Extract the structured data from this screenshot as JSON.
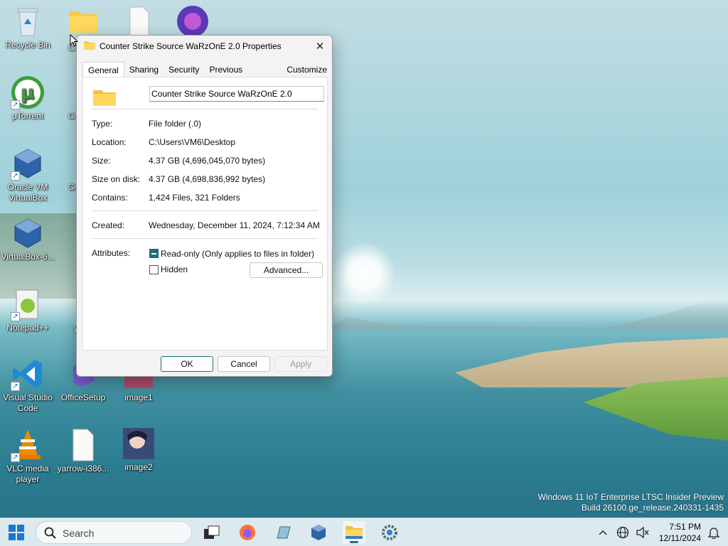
{
  "desktop": {
    "icons": [
      {
        "label": "Recycle Bin"
      },
      {
        "label": "Co Strik"
      },
      {
        "label": "μTorrent"
      },
      {
        "label": "Co Strik"
      },
      {
        "label": "Oracle VM VirtualBox"
      },
      {
        "label": "Co Strik"
      },
      {
        "label": "VirtualBox-6..."
      },
      {
        "label": "Notepad++"
      },
      {
        "label": "yarro"
      },
      {
        "label": "Visual Studio Code"
      },
      {
        "label": "OfficeSetup"
      },
      {
        "label": "image1"
      },
      {
        "label": "VLC media player"
      },
      {
        "label": "yarrow-i386..."
      },
      {
        "label": "image2"
      }
    ]
  },
  "dialog": {
    "title": "Counter Strike Source WaRzOnE 2.0 Properties",
    "tabs": [
      "General",
      "Sharing",
      "Security",
      "Previous Versions",
      "Customize"
    ],
    "name_value": "Counter Strike Source WaRzOnE 2.0",
    "fields": {
      "type_label": "Type:",
      "type_value": "File folder (.0)",
      "location_label": "Location:",
      "location_value": "C:\\Users\\VM6\\Desktop",
      "size_label": "Size:",
      "size_value": "4.37 GB (4,696,045,070 bytes)",
      "size_on_disk_label": "Size on disk:",
      "size_on_disk_value": "4.37 GB (4,698,836,992 bytes)",
      "contains_label": "Contains:",
      "contains_value": "1,424 Files, 321 Folders",
      "created_label": "Created:",
      "created_value": "Wednesday, December 11, 2024, 7:12:34 AM",
      "attributes_label": "Attributes:"
    },
    "attributes": {
      "readonly_label": "Read-only (Only applies to files in folder)",
      "hidden_label": "Hidden",
      "advanced_label": "Advanced..."
    },
    "buttons": {
      "ok": "OK",
      "cancel": "Cancel",
      "apply": "Apply"
    }
  },
  "watermark": {
    "line1": "Windows 11 IoT Enterprise LTSC Insider Preview",
    "line2": "Build 26100.ge_release.240331-1435"
  },
  "taskbar": {
    "search_placeholder": "Search",
    "time": "7:51 PM",
    "date": "12/11/2024"
  },
  "colors": {
    "accent": "#1d6f78",
    "taskbar": "#dce9ee"
  }
}
